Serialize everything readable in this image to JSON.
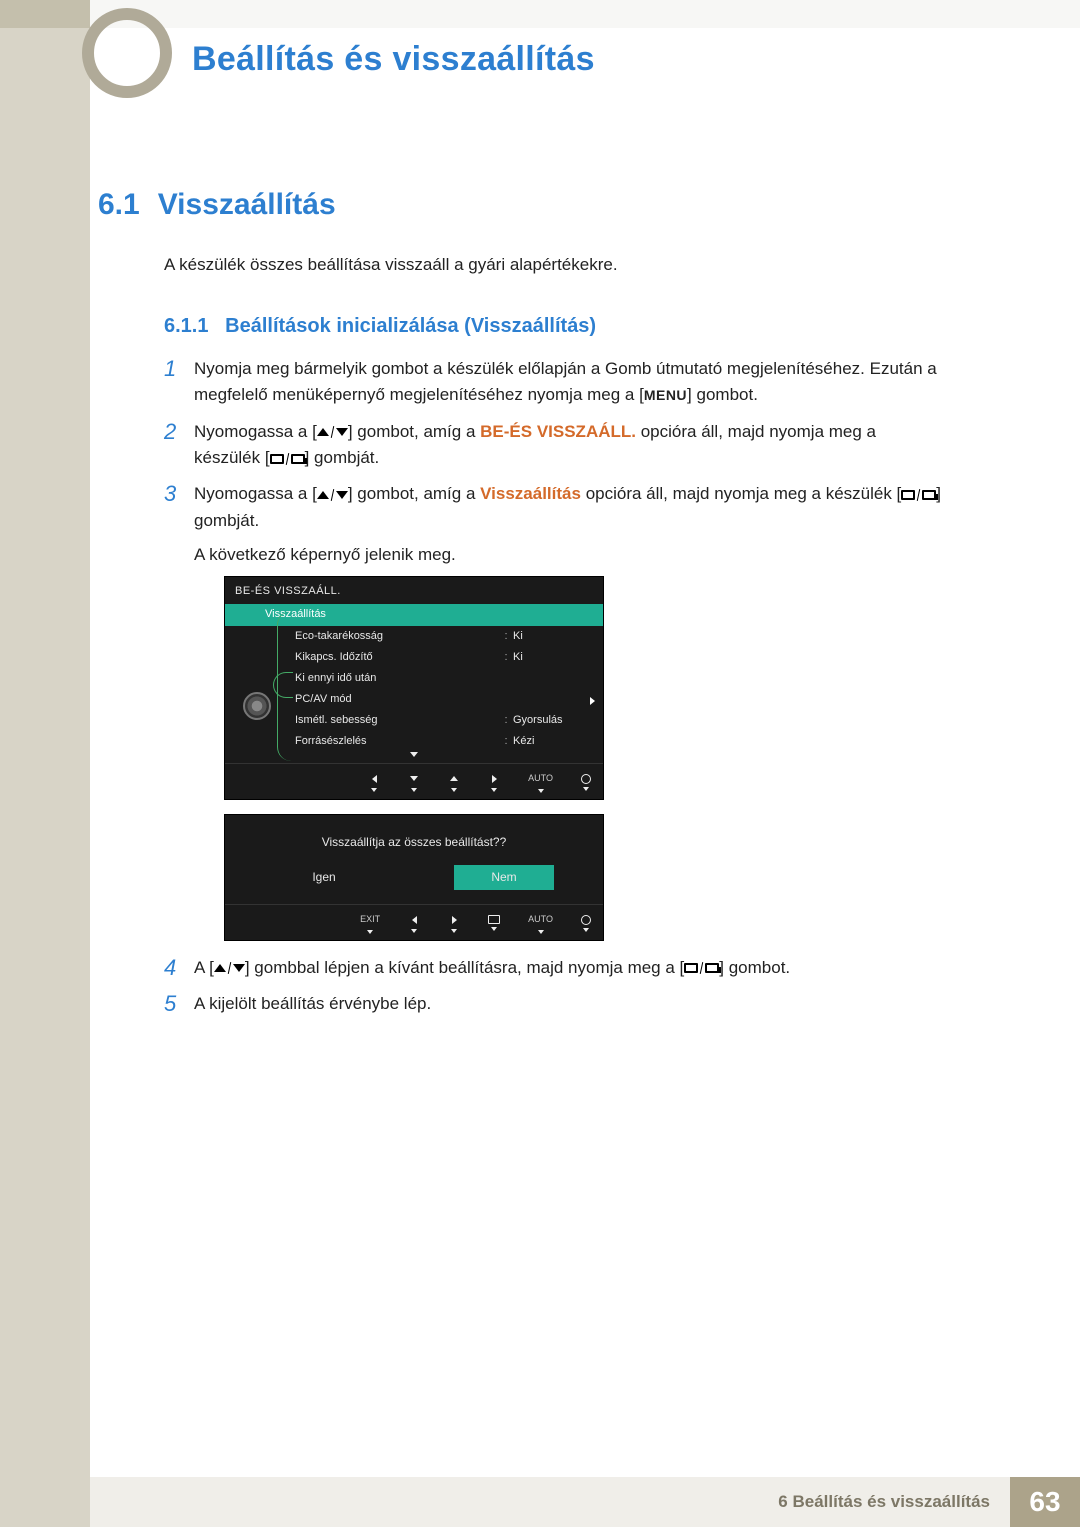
{
  "page": {
    "title": "Beállítás és visszaállítás",
    "section_num": "6.1",
    "section_title": "Visszaállítás",
    "intro": "A készülék összes beállítása visszaáll a gyári alapértékekre.",
    "subsection_num": "6.1.1",
    "subsection_title": "Beállítások inicializálása (Visszaállítás)"
  },
  "steps": {
    "s1_a": "Nyomja meg bármelyik gombot a készülék előlapján a Gomb útmutató megjelenítéséhez. Ezután a megfelelő menüképernyő megjelenítéséhez nyomja meg a [",
    "s1_menu": "MENU",
    "s1_b": "] gombot.",
    "s2_a": "Nyomogassa a [",
    "s2_b": "] gombot, amíg a ",
    "s2_opt": "BE-ÉS VISSZAÁLL.",
    "s2_c": " opcióra áll, majd nyomja meg a készülék [",
    "s2_d": "] gombját.",
    "s3_a": "Nyomogassa a [",
    "s3_b": "] gombot, amíg a ",
    "s3_opt": "Visszaállítás",
    "s3_c": " opcióra áll, majd nyomja meg a készülék [",
    "s3_d": "] gombját.",
    "s3_e": "A következő képernyő jelenik meg.",
    "s4_a": "A [",
    "s4_b": "] gombbal lépjen a kívánt beállításra, majd nyomja meg a [",
    "s4_c": "] gombot.",
    "s5": "A kijelölt beállítás érvénybe lép."
  },
  "osd": {
    "title": "BE-ÉS VISSZAÁLL.",
    "rows": [
      {
        "label": "Visszaállítás",
        "val": "",
        "hl": true
      },
      {
        "label": "Eco-takarékosság",
        "val": "Ki"
      },
      {
        "label": "Kikapcs. Időzítő",
        "val": "Ki"
      },
      {
        "label": "Ki ennyi idő után",
        "val": ""
      },
      {
        "label": "PC/AV mód",
        "val": ""
      },
      {
        "label": "Ismétl. sebesség",
        "val": "Gyorsulás"
      },
      {
        "label": "Forrásészlelés",
        "val": "Kézi"
      }
    ],
    "footer_auto": "AUTO"
  },
  "osd2": {
    "question": "Visszaállítja az összes beállítást??",
    "yes": "Igen",
    "no": "Nem",
    "exit": "EXIT",
    "auto": "AUTO"
  },
  "footer": {
    "chapter": "6 Beállítás és visszaállítás",
    "page_num": "63"
  }
}
